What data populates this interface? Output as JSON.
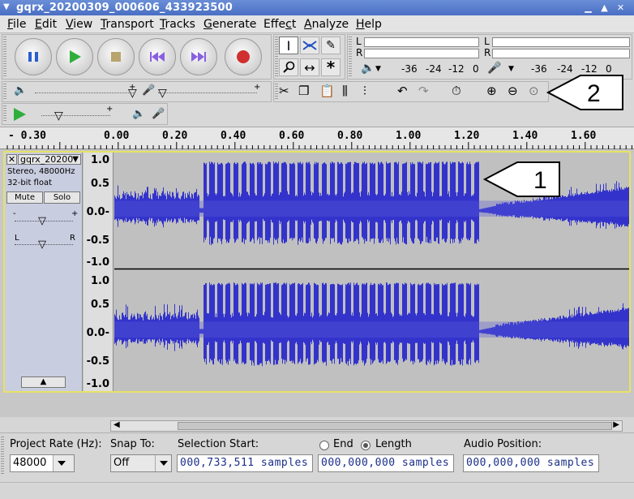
{
  "window": {
    "title": "gqrx_20200309_000606_433923500"
  },
  "menu": [
    {
      "label": "File",
      "u": "F"
    },
    {
      "label": "Edit",
      "u": "E"
    },
    {
      "label": "View",
      "u": "V"
    },
    {
      "label": "Transport",
      "u": "T"
    },
    {
      "label": "Tracks",
      "u": "T"
    },
    {
      "label": "Generate",
      "u": "G"
    },
    {
      "label": "Effect",
      "u": "c"
    },
    {
      "label": "Analyze",
      "u": "A"
    },
    {
      "label": "Help",
      "u": "H"
    }
  ],
  "meters": {
    "record": {
      "left": "L",
      "right": "R",
      "scale": [
        "-36",
        "-24",
        "-12",
        "0"
      ]
    },
    "play": {
      "left": "L",
      "right": "R",
      "scale": [
        "-36",
        "-24",
        "-12",
        "0"
      ]
    }
  },
  "ruler": {
    "labels": [
      "- 0.30",
      "0.00",
      "0.20",
      "0.40",
      "0.60",
      "0.80",
      "1.00",
      "1.20",
      "1.40",
      "1.60"
    ]
  },
  "track": {
    "name": "gqrx_20200",
    "info1": "Stereo, 48000Hz",
    "info2": "32-bit float",
    "mute": "Mute",
    "solo": "Solo",
    "gain_minus": "-",
    "gain_plus": "+",
    "pan_left": "L",
    "pan_right": "R",
    "vscale": [
      "1.0",
      "0.5",
      "0.0-",
      "-0.5",
      "-1.0"
    ],
    "waveform_color": "#3333cc"
  },
  "callouts": {
    "one": "1",
    "two": "2"
  },
  "selection": {
    "project_rate_label": "Project Rate (Hz):",
    "project_rate_value": "48000",
    "snap_to_label": "Snap To:",
    "snap_to_value": "Off",
    "selection_start_label": "Selection Start:",
    "end_label": "End",
    "length_label": "Length",
    "audio_position_label": "Audio Position:",
    "selection_start_value": "000,733,511 samples",
    "length_value": "000,000,000 samples",
    "audio_position_value": "000,000,000 samples"
  }
}
